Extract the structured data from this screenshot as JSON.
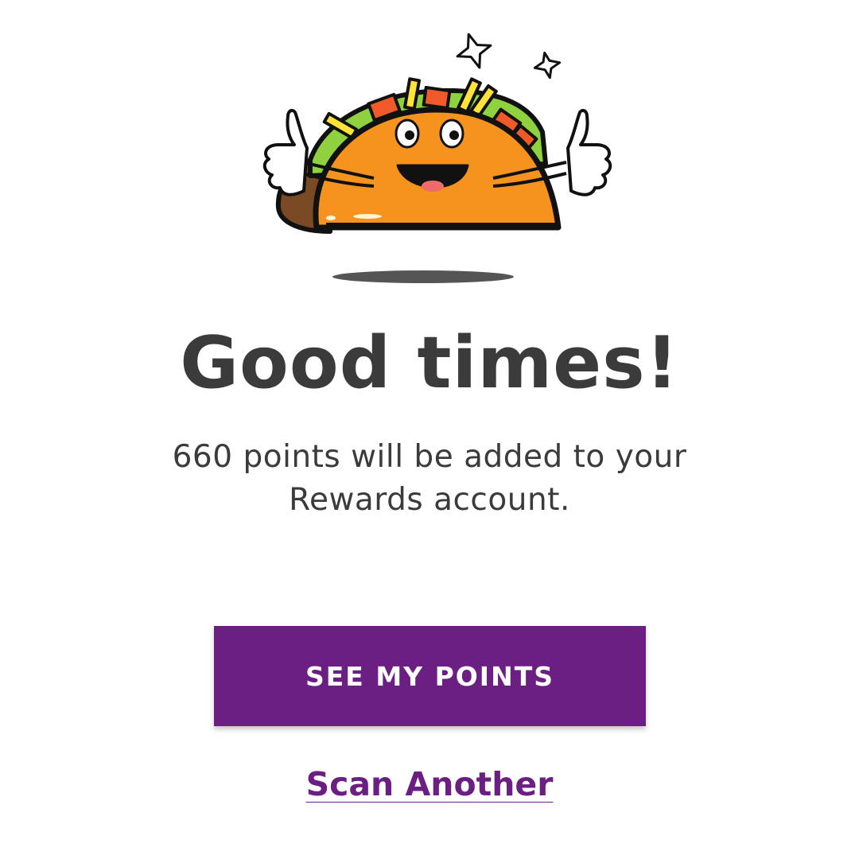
{
  "colors": {
    "accent": "#6c1f82",
    "text": "#3b3b3b",
    "background": "#ffffff",
    "taco_shell": "#f6921e",
    "taco_outline": "#111111"
  },
  "illustration": {
    "icon": "happy-taco-mascot-thumbs-up-icon"
  },
  "headline": "Good times!",
  "message": {
    "points": "660",
    "text": " points will be added to your Rewards account."
  },
  "actions": {
    "primary_label": "SEE MY POINTS",
    "secondary_label": "Scan Another"
  }
}
